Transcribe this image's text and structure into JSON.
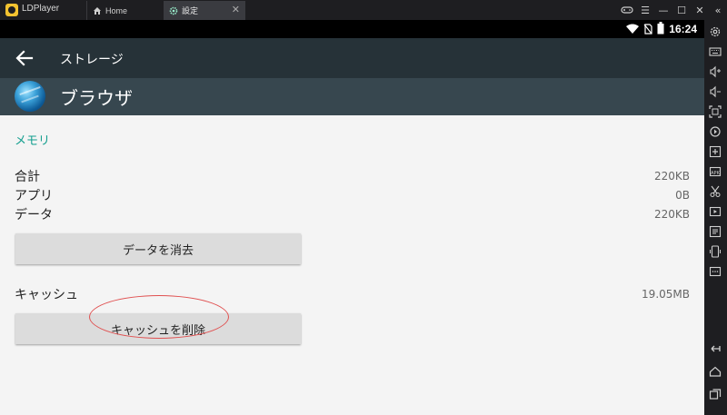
{
  "titlebar": {
    "app_name": "LDPlayer",
    "tabs": [
      {
        "label": "Home",
        "icon": "home-icon"
      },
      {
        "label": "設定",
        "icon": "gear-icon",
        "active": true
      }
    ],
    "window_controls": [
      "gamepad-icon",
      "menu-icon",
      "minimize-icon",
      "maximize-icon",
      "close-icon",
      "collapse-sidebar-icon"
    ]
  },
  "statusbar": {
    "icons": [
      "wifi-icon",
      "no-sim-icon",
      "battery-icon"
    ],
    "time": "16:24"
  },
  "actionbar": {
    "title": "ストレージ",
    "back_icon": "back-arrow-icon"
  },
  "app": {
    "name": "ブラウザ",
    "icon": "browser-globe-icon"
  },
  "memory": {
    "section_title": "メモリ",
    "rows": [
      {
        "label": "合計",
        "value": "220KB"
      },
      {
        "label": "アプリ",
        "value": "0B"
      },
      {
        "label": "データ",
        "value": "220KB"
      }
    ],
    "clear_data_button": "データを消去"
  },
  "cache": {
    "label": "キャッシュ",
    "value": "19.05MB",
    "clear_cache_button": "キャッシュを削除"
  },
  "sidebar": {
    "icons": [
      "settings-icon",
      "keyboard-icon",
      "volume-up-icon",
      "volume-down-icon",
      "fullscreen-icon",
      "sync-icon",
      "add-apk-icon",
      "screenshot-icon",
      "scissors-icon",
      "video-icon",
      "operations-icon",
      "device-icon",
      "more-icon",
      "back-icon",
      "home-nav-icon",
      "recents-icon"
    ]
  },
  "colors": {
    "accent": "#159f8f",
    "actionbar": "#263238",
    "app_header": "#37474f",
    "annotation": "#e05050"
  }
}
